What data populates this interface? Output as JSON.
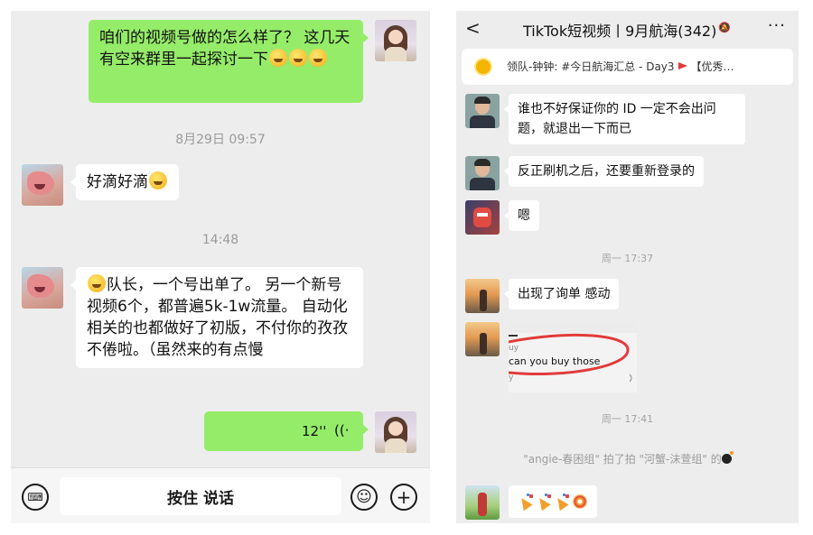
{
  "left_chat": {
    "messages": [
      {
        "type": "text",
        "text": "咱们的视频号做的怎么样了？ 这几天有空来群里一起探讨一下"
      },
      {
        "type": "timestamp",
        "text": "8月29日 09:57"
      },
      {
        "type": "text",
        "text": "好滴好滴"
      },
      {
        "type": "timestamp",
        "text": "14:48"
      },
      {
        "type": "text",
        "text": "队长，一个号出单了。 另一个新号视频6个，都普遍5k-1w流量。 自动化相关的也都做好了初版，不付你的孜孜不倦啦。（虽然来的有点慢"
      },
      {
        "type": "voice",
        "text": "12''"
      }
    ],
    "input_bar": {
      "hold_to_talk_label": "按住 说话"
    }
  },
  "right_chat": {
    "header": {
      "back_glyph": "<",
      "title": "TikTok短视频丨9月航海(342)",
      "more_glyph": "···"
    },
    "notice": {
      "text_before_flag": "领队-钟钟: #今日航海汇总 - Day3",
      "text_after_flag": "【优秀…"
    },
    "messages": [
      {
        "type": "text",
        "text": "谁也不好保证你的 ID 一定不会出问题，就退出一下而已"
      },
      {
        "type": "text",
        "text": "反正刷机之后，还要重新登录的"
      },
      {
        "type": "text",
        "text": "嗯"
      },
      {
        "type": "timestamp",
        "text": "周一 17:37"
      },
      {
        "type": "text",
        "text": "出现了询单 感动"
      },
      {
        "type": "image",
        "lines": [
          "uy",
          "can you buy those",
          "y"
        ]
      },
      {
        "type": "timestamp",
        "text": "周一 17:41"
      },
      {
        "type": "system",
        "text": "\"angie-春困组\" 拍了拍 \"河蟹-沫萱组\" 的"
      }
    ]
  },
  "colors": {
    "chat_bg": "#ededed",
    "green_bubble": "#95ec69",
    "white_bubble": "#ffffff",
    "timestamp": "#9b9b9b"
  },
  "icons": [
    "keyboard-icon",
    "emoji-icon",
    "plus-icon",
    "voice-wave-icon",
    "mute-bell-icon",
    "sun-icon",
    "flag-icon",
    "bomb-icon",
    "party-popper-icon",
    "firework-icon"
  ]
}
